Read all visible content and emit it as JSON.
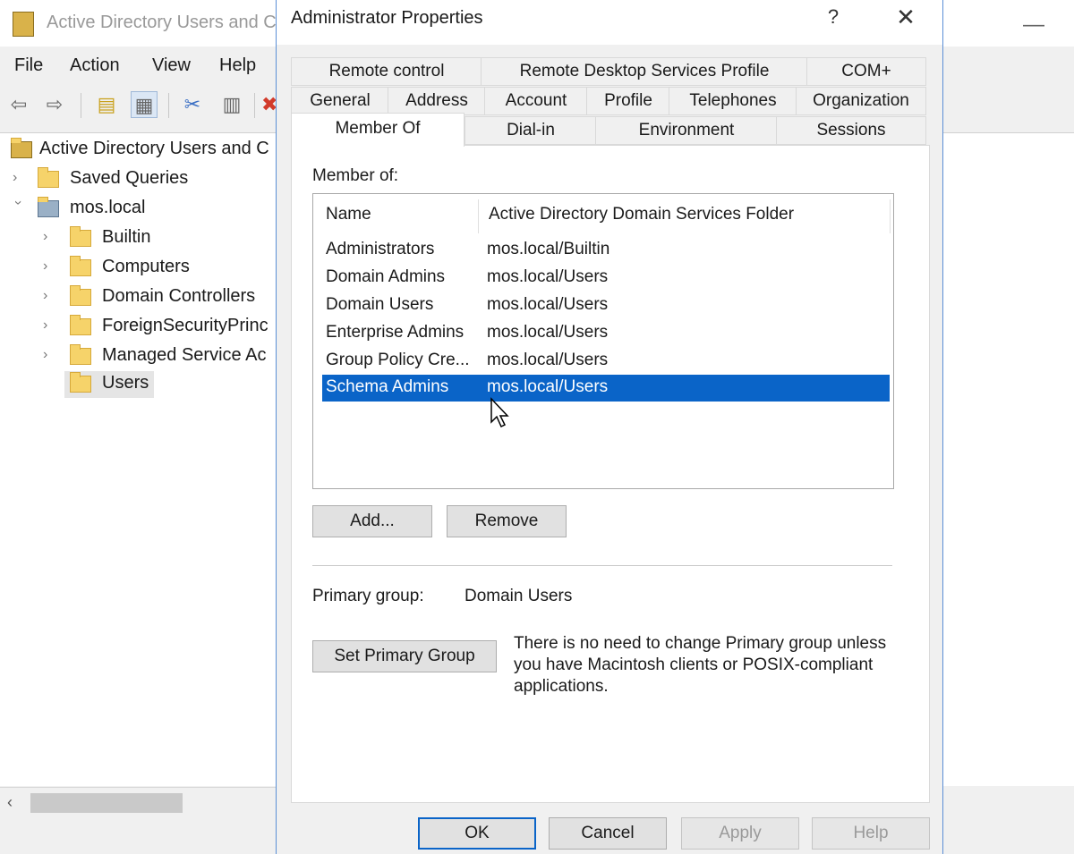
{
  "background_window": {
    "title": "Active Directory Users and C",
    "menu": [
      "File",
      "Action",
      "View",
      "Help"
    ],
    "tree": {
      "root": "Active Directory Users and C",
      "items": [
        {
          "label": "Saved Queries"
        },
        {
          "label": "mos.local"
        },
        {
          "label": "Builtin"
        },
        {
          "label": "Computers"
        },
        {
          "label": "Domain Controllers"
        },
        {
          "label": "ForeignSecurityPrinc"
        },
        {
          "label": "Managed Service Ac"
        },
        {
          "label": "Users"
        }
      ]
    }
  },
  "dialog": {
    "title": "Administrator Properties",
    "help_glyph": "?",
    "close_glyph": "✕",
    "tabs": {
      "row1": [
        "Remote control",
        "Remote Desktop Services Profile",
        "COM+"
      ],
      "row2": [
        "General",
        "Address",
        "Account",
        "Profile",
        "Telephones",
        "Organization"
      ],
      "row3": [
        "Member Of",
        "Dial-in",
        "Environment",
        "Sessions"
      ]
    },
    "active_tab": "Member Of",
    "member_of_label": "Member of:",
    "columns": [
      "Name",
      "Active Directory Domain Services Folder"
    ],
    "rows": [
      {
        "name": "Administrators",
        "folder": "mos.local/Builtin",
        "selected": false
      },
      {
        "name": "Domain Admins",
        "folder": "mos.local/Users",
        "selected": false
      },
      {
        "name": "Domain Users",
        "folder": "mos.local/Users",
        "selected": false
      },
      {
        "name": "Enterprise Admins",
        "folder": "mos.local/Users",
        "selected": false
      },
      {
        "name": "Group Policy Cre...",
        "folder": "mos.local/Users",
        "selected": false
      },
      {
        "name": "Schema Admins",
        "folder": "mos.local/Users",
        "selected": true
      }
    ],
    "add_button": "Add...",
    "remove_button": "Remove",
    "primary_group_label": "Primary group:",
    "primary_group_value": "Domain Users",
    "set_primary_group_button": "Set Primary Group",
    "primary_group_note": "There is no need to change Primary group unless you have Macintosh clients or POSIX-compliant applications.",
    "footer": {
      "ok": "OK",
      "cancel": "Cancel",
      "apply": "Apply",
      "help": "Help"
    }
  },
  "colors": {
    "selection": "#0a64c8",
    "dialog_border": "#5b8fd6",
    "window_bg": "#f0f0f0"
  }
}
